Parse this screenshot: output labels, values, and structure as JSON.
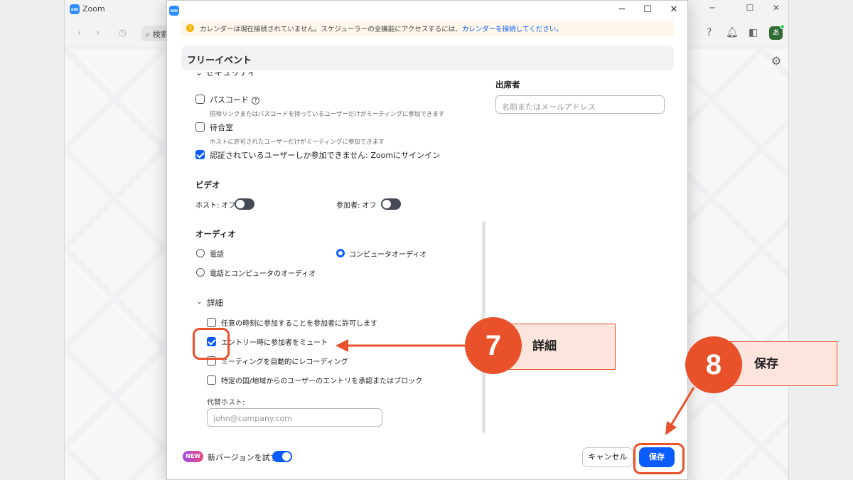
{
  "background_window": {
    "title": "Zoom",
    "search_text": "検索",
    "avatar_text": "あ"
  },
  "dialog": {
    "warning": {
      "text": "カレンダーは現在接続されていません。スケジューラーの全機能にアクセスするには、",
      "link": "カレンダーを接続してください。"
    },
    "event_title": "フリーイベント",
    "cut_section_title": "セキュリティ",
    "security": [
      {
        "label": "パスコード",
        "checked": false,
        "sub": "招待リンクまたはパスコードを持っているユーザーだけがミーティングに参加できます"
      },
      {
        "label": "待合室",
        "checked": false,
        "sub": "ホストに許可されたユーザーだけがミーティングに参加できます"
      },
      {
        "label": "認証されているユーザーしか参加できません: Zoomにサインイン",
        "checked": true
      }
    ],
    "video": {
      "title": "ビデオ",
      "host_label": "ホスト: オフ",
      "participant_label": "参加者: オフ",
      "host_on": false,
      "participant_on": false
    },
    "audio": {
      "title": "オーディオ",
      "options": [
        "電話",
        "コンピュータオーディオ",
        "電話とコンピュータのオーディオ"
      ],
      "selected": "コンピュータオーディオ"
    },
    "advanced": {
      "title": "詳細",
      "options": [
        {
          "label": "任意の時刻に参加することを参加者に許可します",
          "checked": false
        },
        {
          "label": "エントリー時に参加者をミュート",
          "checked": true
        },
        {
          "label": "ミーティングを自動的にレコーディング",
          "checked": false
        },
        {
          "label": "特定の国/地域からのユーザーのエントリを承認またはブロック",
          "checked": false
        }
      ],
      "alt_host_label": "代替ホスト:",
      "alt_host_placeholder": "john@company.com"
    },
    "attendees": {
      "title": "出席者",
      "placeholder": "名前またはメールアドレス"
    },
    "footer": {
      "new_badge": "NEW",
      "new_version_label": "新バージョンを試す",
      "new_version_on": true,
      "cancel": "キャンセル",
      "save": "保存"
    }
  },
  "annotations": {
    "step7": {
      "number": "7",
      "label": "詳細"
    },
    "step8": {
      "number": "8",
      "label": "保存"
    },
    "color": "#e8512a"
  }
}
